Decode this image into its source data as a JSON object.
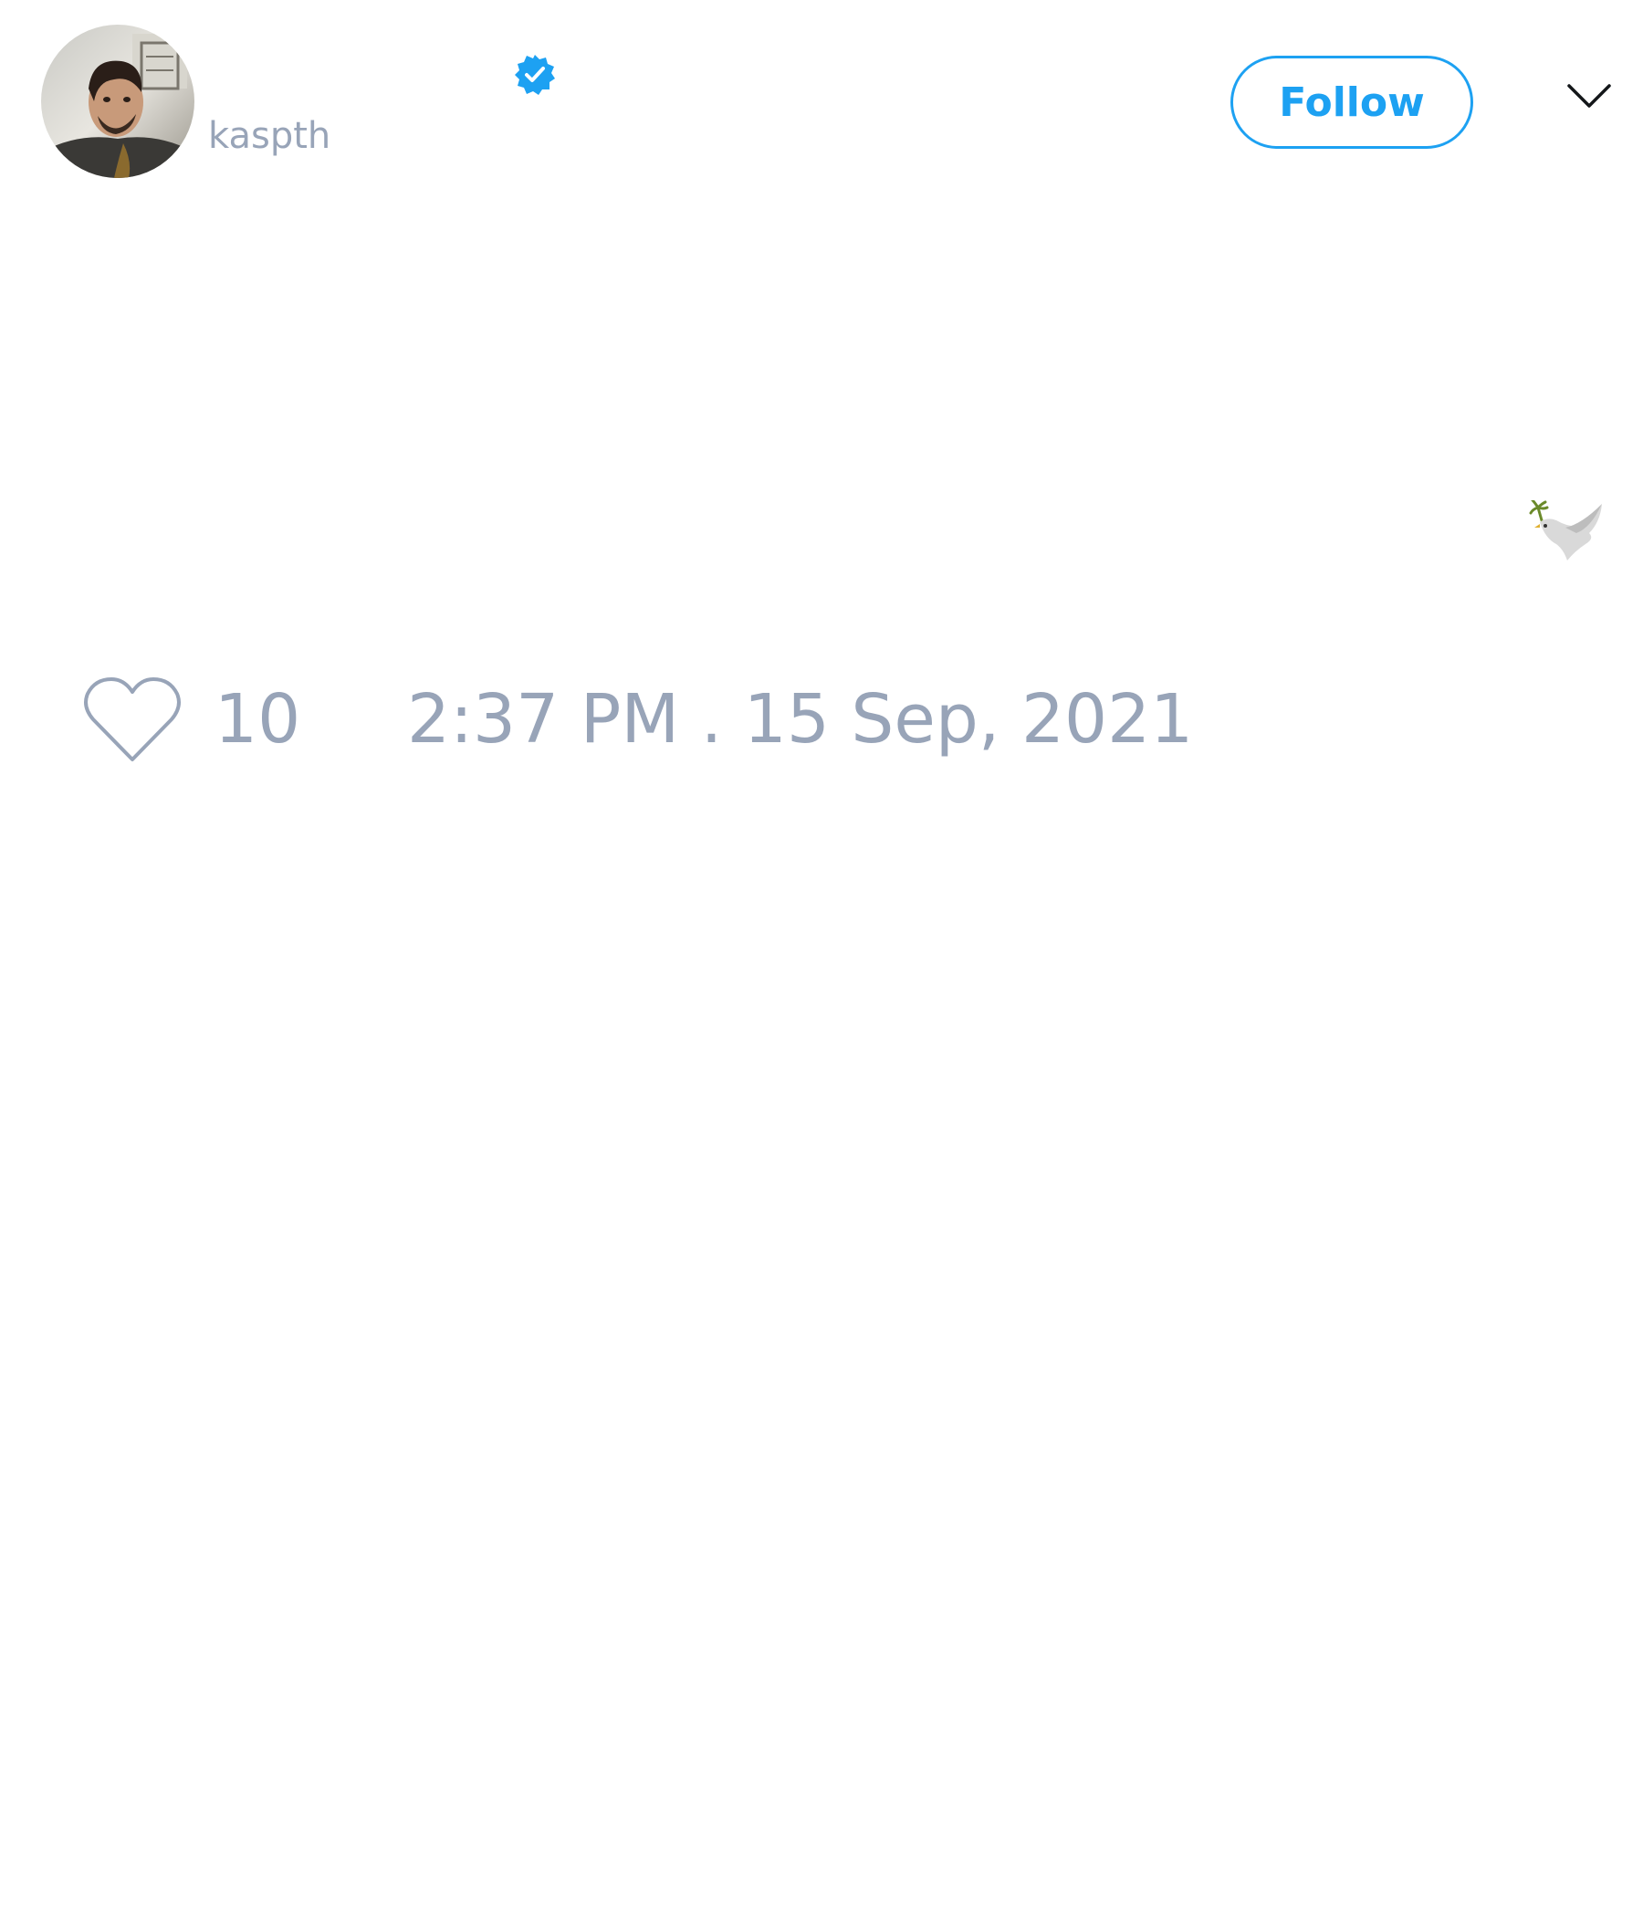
{
  "author": {
    "display_name": "",
    "handle": "kaspth",
    "verified": true
  },
  "header": {
    "follow_label": "Follow"
  },
  "tweet": {
    "text": "",
    "emoji": "dove",
    "like_count": "10",
    "timestamp": "2:37 PM . 15 Sep, 2021"
  },
  "colors": {
    "accent": "#1da1f2",
    "muted_text": "#98a4b8",
    "background": "#ffffff"
  },
  "icons": {
    "verified": "verified-badge-icon",
    "caret": "chevron-down-icon",
    "like": "heart-icon",
    "emoji": "dove-emoji"
  }
}
